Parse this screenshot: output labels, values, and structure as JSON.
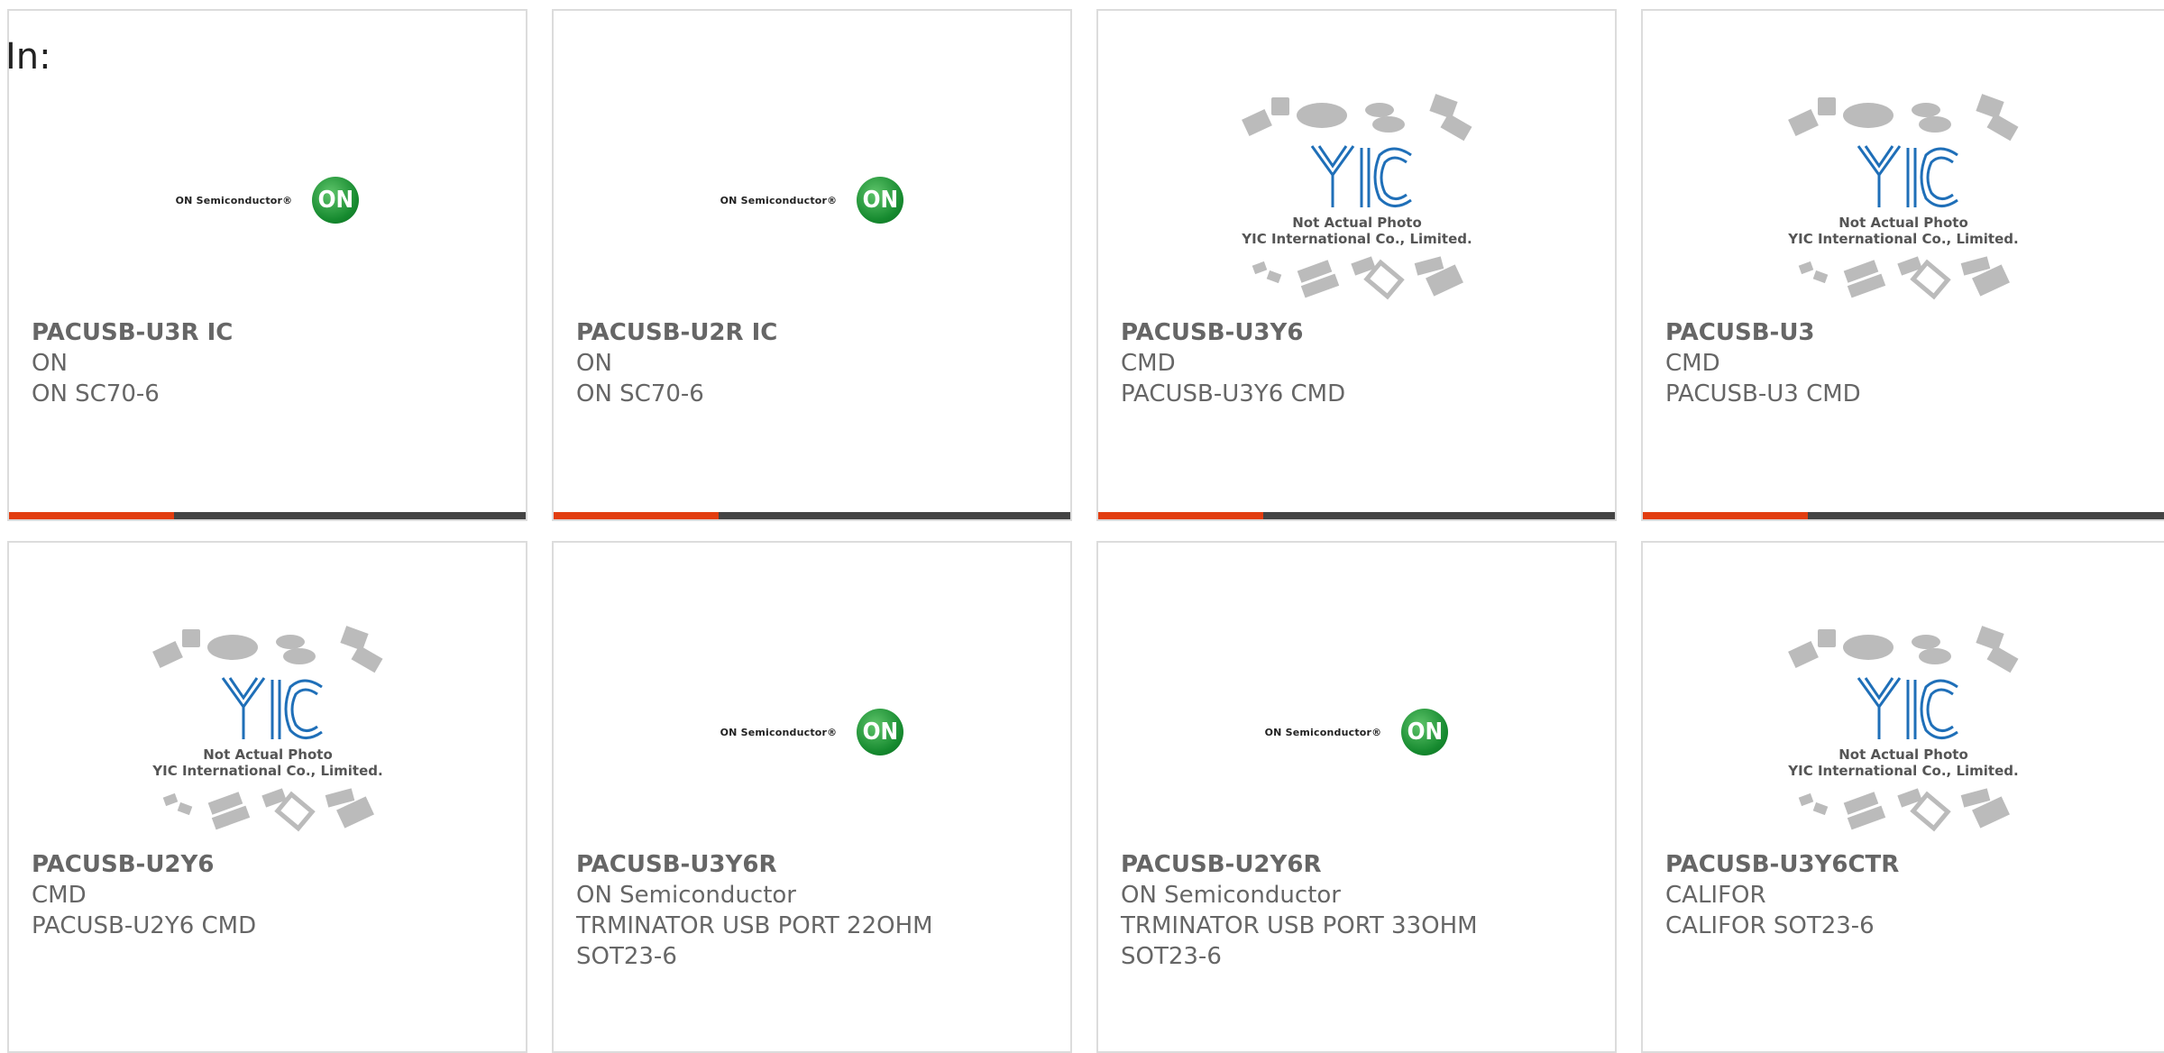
{
  "header": {
    "label": "In:"
  },
  "colors": {
    "accent": "#e23d10",
    "bar": "#444444",
    "border": "#dcdcdc"
  },
  "products": [
    {
      "title": "PACUSB-U3R IC",
      "lines": [
        "ON",
        "ON SC70-6"
      ],
      "image": "on-semiconductor-logo",
      "logo_text": "ON Semiconductor®",
      "logo_mark": "ON"
    },
    {
      "title": "PACUSB-U2R IC",
      "lines": [
        "ON",
        "ON SC70-6"
      ],
      "image": "on-semiconductor-logo",
      "logo_text": "ON Semiconductor®",
      "logo_mark": "ON"
    },
    {
      "title": "PACUSB-U3Y6",
      "lines": [
        "CMD",
        "PACUSB-U3Y6 CMD"
      ],
      "image": "yic-not-actual-photo",
      "caption1": "Not Actual Photo",
      "caption2": "YIC International Co., Limited."
    },
    {
      "title": "PACUSB-U3",
      "lines": [
        "CMD",
        "PACUSB-U3 CMD"
      ],
      "image": "yic-not-actual-photo",
      "caption1": "Not Actual Photo",
      "caption2": "YIC International Co., Limited."
    },
    {
      "title": "PACUSB-U2Y6",
      "lines": [
        "CMD",
        "PACUSB-U2Y6 CMD"
      ],
      "image": "yic-not-actual-photo",
      "caption1": "Not Actual Photo",
      "caption2": "YIC International Co., Limited."
    },
    {
      "title": "PACUSB-U3Y6R",
      "lines": [
        "ON Semiconductor",
        "TRMINATOR USB PORT 22OHM",
        "SOT23-6"
      ],
      "image": "on-semiconductor-logo",
      "logo_text": "ON Semiconductor®",
      "logo_mark": "ON"
    },
    {
      "title": "PACUSB-U2Y6R",
      "lines": [
        "ON Semiconductor",
        "TRMINATOR USB PORT 33OHM",
        "SOT23-6"
      ],
      "image": "on-semiconductor-logo",
      "logo_text": "ON Semiconductor®",
      "logo_mark": "ON"
    },
    {
      "title": "PACUSB-U3Y6CTR",
      "lines": [
        "CALIFOR",
        "CALIFOR SOT23-6"
      ],
      "image": "yic-not-actual-photo",
      "caption1": "Not Actual Photo",
      "caption2": "YIC International Co., Limited."
    }
  ]
}
